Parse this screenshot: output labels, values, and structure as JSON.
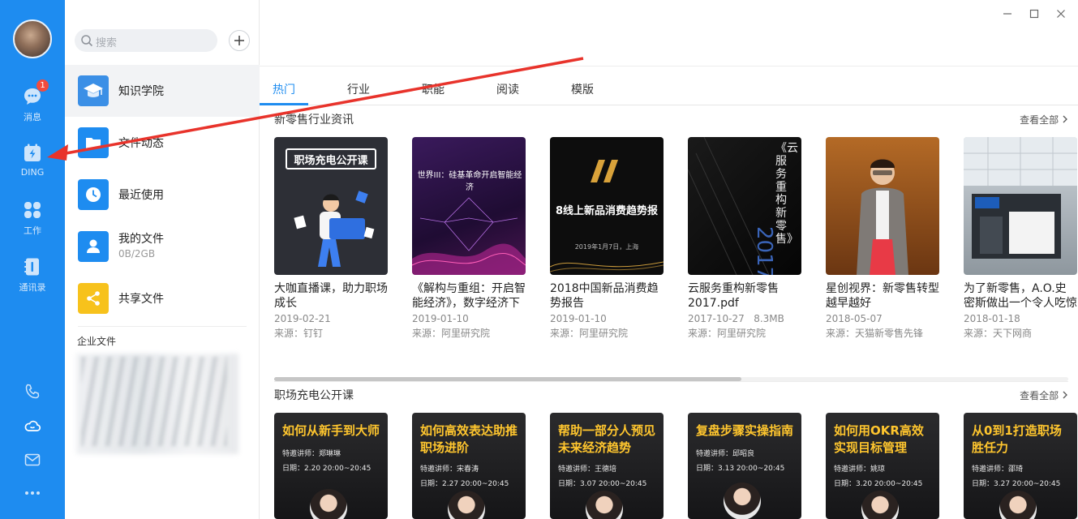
{
  "rail": {
    "badge": "1",
    "items": [
      {
        "label": "消息"
      },
      {
        "label": "DING"
      },
      {
        "label": "工作"
      },
      {
        "label": "通讯录"
      }
    ]
  },
  "mid": {
    "search_placeholder": "搜索",
    "nav": [
      {
        "label": "知识学院",
        "color": "#3b8fe6"
      },
      {
        "label": "文件动态",
        "color": "#1e8cf0"
      },
      {
        "label": "最近使用",
        "color": "#1e8cf0"
      },
      {
        "label": "我的文件",
        "sub": "0B/2GB",
        "color": "#1e8cf0"
      },
      {
        "label": "共享文件",
        "color": "#f7c21c"
      }
    ],
    "section": "企业文件"
  },
  "tabs": [
    "热门",
    "行业",
    "职能",
    "阅读",
    "模版"
  ],
  "section1": {
    "title": "新零售行业资讯",
    "see_all": "查看全部",
    "cards": [
      {
        "title": "大咖直播课，助力职场成长",
        "date": "2019-02-21",
        "src": "来源：钉钉",
        "thumb": "职场充电公开课"
      },
      {
        "title": "《解构与重组：开启智能经济》，数字经济下",
        "date": "2019-01-10",
        "src": "来源：阿里研究院",
        "thumb": "世界III：硅基革命开启智能经济"
      },
      {
        "title": "2018中国新品消费趋势报告",
        "date": "2019-01-10",
        "src": "来源：阿里研究院",
        "thumb": "8线上新品消费趋势报",
        "thumb_sub": "2019年1月7日，上海"
      },
      {
        "title": "云服务重构新零售2017.pdf",
        "date": "2017-10-27",
        "size": "8.3MB",
        "src": "来源：阿里研究院",
        "thumb": "《云服务重构新零售》"
      },
      {
        "title": "星创视界：新零售转型越早越好",
        "date": "2018-05-07",
        "src": "来源：天猫新零售先锋",
        "thumb": ""
      },
      {
        "title": "为了新零售，A.O.史密斯做出一个令人吃惊",
        "date": "2018-01-18",
        "src": "来源：天下网商",
        "thumb": ""
      }
    ]
  },
  "section2": {
    "title": "职场充电公开课",
    "see_all": "查看全部",
    "courses": [
      {
        "title": "如何从新手到大师",
        "lecturer": "特邀讲师：郑琳琳",
        "date": "日期：2.20 20:00~20:45"
      },
      {
        "title": "如何高效表达助推职场进阶",
        "lecturer": "特邀讲师：宋春涛",
        "date": "日期：2.27 20:00~20:45"
      },
      {
        "title": "帮助一部分人预见未来经济趋势",
        "lecturer": "特邀讲师：王德培",
        "date": "日期：3.07 20:00~20:45"
      },
      {
        "title": "复盘步骤实操指南",
        "lecturer": "特邀讲师：邱昭良",
        "date": "日期：3.13 20:00~20:45"
      },
      {
        "title": "如何用OKR高效实现目标管理",
        "lecturer": "特邀讲师：姚琼",
        "date": "日期：3.20 20:00~20:45"
      },
      {
        "title": "从0到1打造职场胜任力",
        "lecturer": "特邀讲师：邵琦",
        "date": "日期：3.27 20:00~20:45"
      }
    ]
  },
  "colors": {
    "accent": "#1e8cf0",
    "rail": "#1e8cf0",
    "annotation": "#e8332b"
  }
}
